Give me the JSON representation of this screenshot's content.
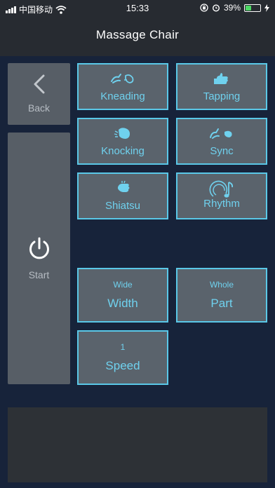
{
  "status_bar": {
    "carrier": "中国移动",
    "time": "15:33",
    "battery_percent": "39%",
    "battery_level": 0.39,
    "icons": [
      "signal-icon",
      "wifi-icon",
      "orientation-lock-icon",
      "alarm-icon",
      "battery-icon",
      "charging-icon"
    ]
  },
  "nav": {
    "title": "Massage Chair"
  },
  "side": {
    "back_label": "Back",
    "start_label": "Start"
  },
  "modes": [
    {
      "label": "Kneading",
      "icon": "kneading-hands-icon"
    },
    {
      "label": "Tapping",
      "icon": "tapping-hand-icon"
    },
    {
      "label": "Knocking",
      "icon": "knocking-hand-icon"
    },
    {
      "label": "Sync",
      "icon": "sync-hands-icon"
    },
    {
      "label": "Shiatsu",
      "icon": "shiatsu-hand-icon"
    },
    {
      "label": "Rhythm",
      "icon": "rhythm-music-icon"
    }
  ],
  "settings": {
    "width": {
      "value": "Wide",
      "label": "Width"
    },
    "part": {
      "value": "Whole",
      "label": "Part"
    },
    "speed": {
      "value": "1",
      "label": "Speed"
    }
  },
  "colors": {
    "background": "#17233a",
    "accent": "#5ac8e8",
    "tile": "#5a636c",
    "nav": "#272b31"
  }
}
